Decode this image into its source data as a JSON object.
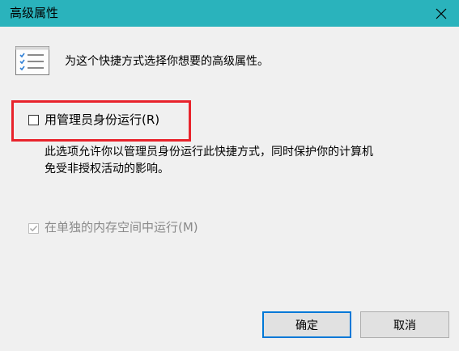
{
  "window": {
    "title": "高级属性",
    "close_icon": "close-icon"
  },
  "header": {
    "icon": "properties-list-icon",
    "description": "为这个快捷方式选择你想要的高级属性。"
  },
  "options": {
    "run_as_admin": {
      "label": "用管理员身份运行(R)",
      "checked": false,
      "enabled": true,
      "description_line1": "此选项允许你以管理员身份运行此快捷方式，同时保护你的计算机",
      "description_line2": "免受非授权活动的影响。"
    },
    "run_separate_memory": {
      "label": "在单独的内存空间中运行(M)",
      "checked": true,
      "enabled": false
    }
  },
  "buttons": {
    "ok_label": "确定",
    "cancel_label": "取消"
  },
  "colors": {
    "titlebar": "#2ab3bc",
    "dialog_background": "#f0f0f0",
    "highlight": "#e8232c",
    "default_button_border": "#0078d7"
  }
}
